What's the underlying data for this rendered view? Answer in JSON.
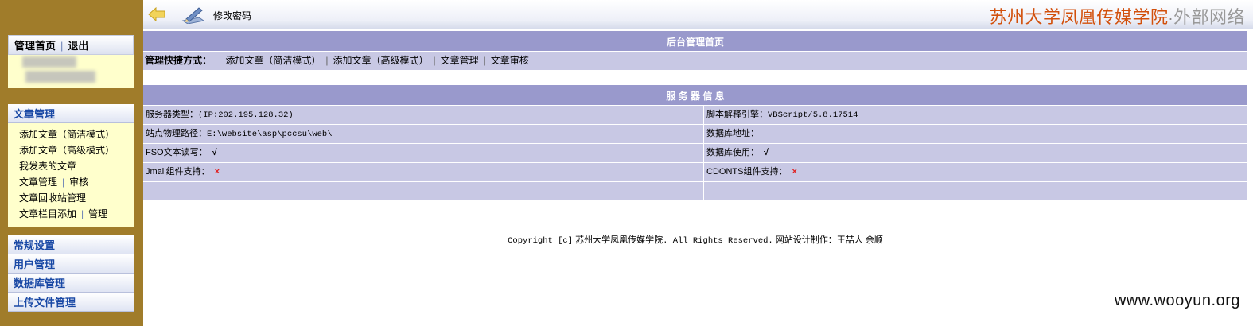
{
  "sidebar": {
    "head": {
      "home_label": "管理首页",
      "logout_label": "退出"
    },
    "article_menu": {
      "title": "文章管理",
      "items": {
        "add_simple": "添加文章（简洁模式）",
        "add_advanced": "添加文章（高级模式）",
        "my_articles": "我发表的文章",
        "manage": "文章管理",
        "review": "审核",
        "recycle": "文章回收站管理",
        "column_add": "文章栏目添加",
        "column_manage": "管理"
      }
    },
    "sections": [
      "常规设置",
      "用户管理",
      "数据库管理",
      "上传文件管理"
    ]
  },
  "topbar": {
    "change_password": "修改密码",
    "site_title": "苏州大学凤凰传媒学院",
    "site_dot": "·",
    "site_sub": "外部网络"
  },
  "main": {
    "home_header": "后台管理首页",
    "quick": {
      "label": "管理快捷方式：",
      "links": [
        "添加文章（简洁模式）",
        "添加文章（高级模式）",
        "文章管理",
        "文章审核"
      ]
    },
    "server_header": "服 务 器 信 息",
    "info": {
      "server_type_label": "服务器类型：",
      "server_type_value": "(IP:202.195.128.32)",
      "script_engine_label": "脚本解释引擎：",
      "script_engine_value": "VBScript/5.8.17514",
      "path_label": "站点物理路径：",
      "path_value": "E:\\website\\asp\\pccsu\\web\\",
      "db_addr_label": "数据库地址：",
      "fso_label": "FSO文本读写：",
      "fso_value": "√",
      "db_use_label": "数据库使用：",
      "db_use_value": "√",
      "jmail_label": "Jmail组件支持：",
      "jmail_value": "×",
      "cdonts_label": "CDONTS组件支持：",
      "cdonts_value": "×"
    }
  },
  "footer": {
    "copy_prefix": "Copyright [c]",
    "org": "苏州大学凤凰传媒学院",
    "rights": ". All Rights Reserved.",
    "design": "网站设计制作：王喆人 余顺"
  },
  "watermark": "www.wooyun.org",
  "colors": {
    "sidebar_bg": "#a07c2a",
    "band": "#9999cc",
    "row": "#c8c8e4",
    "title_orange": "#d2500c",
    "menu_blue": "#1a49a5",
    "menu_bg": "#ffffcc"
  }
}
